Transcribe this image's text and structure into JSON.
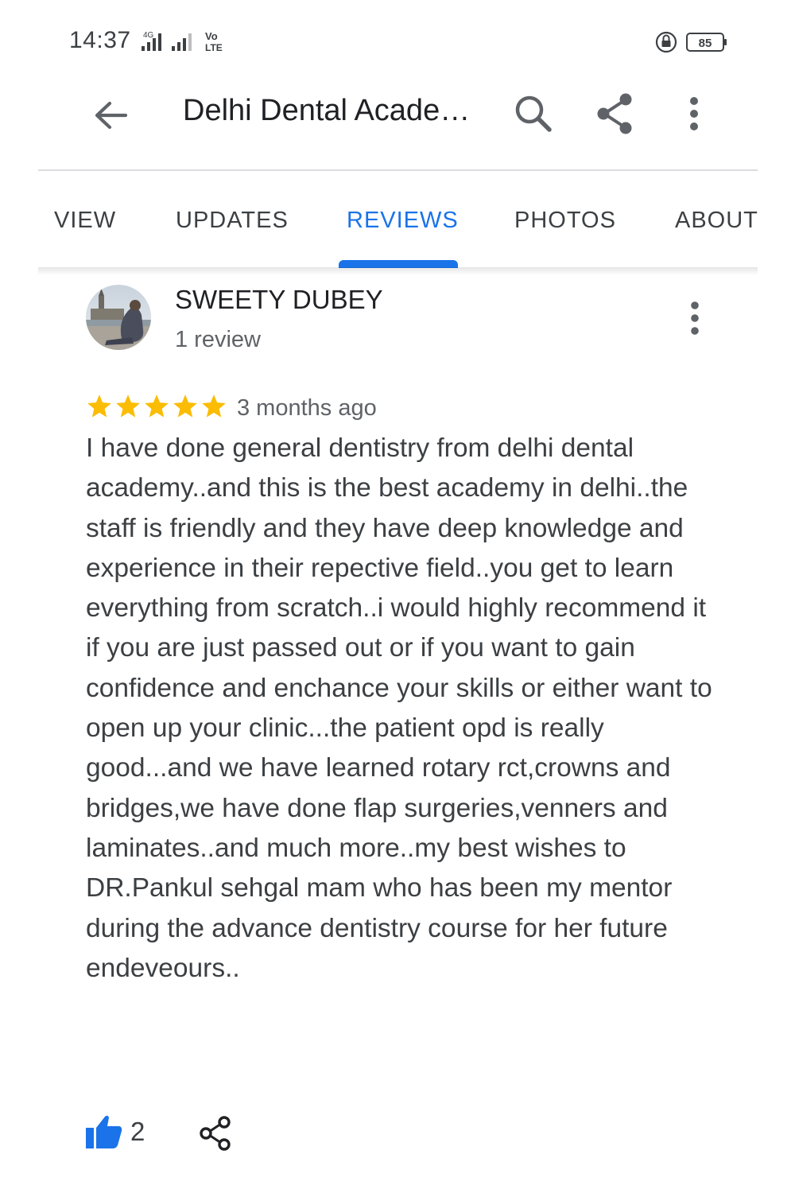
{
  "status_bar": {
    "time": "14:37",
    "network_label": "4G",
    "volte_label": "Vo LTE",
    "battery_level": "85"
  },
  "header": {
    "title": "Delhi Dental Acade…",
    "icons": [
      "back-arrow-icon",
      "search-icon",
      "share-icon",
      "more-vertical-icon"
    ]
  },
  "tabs": [
    {
      "label": "VIEW",
      "active": false
    },
    {
      "label": "UPDATES",
      "active": false
    },
    {
      "label": "REVIEWS",
      "active": true
    },
    {
      "label": "PHOTOS",
      "active": false
    },
    {
      "label": "ABOUT",
      "active": false
    }
  ],
  "review": {
    "reviewer_name": "SWEETY DUBEY",
    "reviewer_review_count": "1 review",
    "rating": 5,
    "date": "3 months ago",
    "text": "I have done general dentistry from delhi dental academy..and this is the best academy in delhi..the staff is friendly and they have deep knowledge and experience in their repective field..you get to learn everything from scratch..i would highly recommend it if you are just passed out or if you want to gain confidence and enchance your skills or either want to open up your clinic...the patient opd is really good...and we have learned rotary rct,crowns and bridges,we have done flap surgeries,venners and laminates..and much more..my best wishes to DR.Pankul sehgal mam who has been my mentor during the advance dentistry course for her future endeveours..",
    "likes": "2"
  },
  "colors": {
    "accent": "#1a73e8",
    "star": "#fbbc04",
    "text_primary": "#202124",
    "text_secondary": "#5f6368"
  }
}
